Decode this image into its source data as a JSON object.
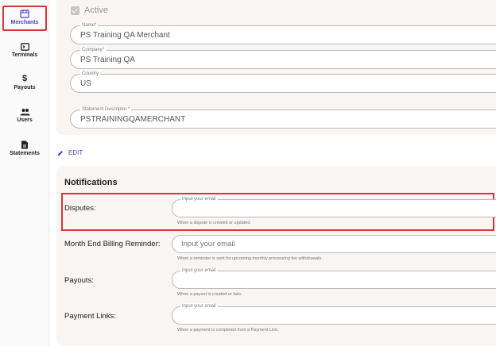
{
  "sidebar": {
    "items": [
      {
        "label": "Merchants",
        "icon": "storefront-icon",
        "active": true
      },
      {
        "label": "Terminals",
        "icon": "terminal-icon",
        "active": false
      },
      {
        "label": "Payouts",
        "icon": "dollar-icon",
        "active": false
      },
      {
        "label": "Users",
        "icon": "users-icon",
        "active": false
      },
      {
        "label": "Statements",
        "icon": "document-icon",
        "active": false
      }
    ]
  },
  "merchant": {
    "active_label": "Active",
    "fields": [
      {
        "label": "Name",
        "required": true,
        "value": "PS Training QA Merchant"
      },
      {
        "label": "Company",
        "required": true,
        "value": "PS Training QA"
      },
      {
        "label": "Country",
        "required": false,
        "value": "US"
      },
      {
        "label": "Statement Descriptor",
        "required": true,
        "value": "PSTRAININGQAMERCHANT"
      }
    ]
  },
  "edit_label": "EDIT",
  "notifications": {
    "title": "Notifications",
    "rows": [
      {
        "label": "Disputes:",
        "field_label": "Input your email",
        "placeholder": "",
        "helper": "When a dispute is created or updated."
      },
      {
        "label": "Month End Billing Reminder:",
        "field_label": "",
        "placeholder": "Input your email",
        "helper": "When a reminder is sent for upcoming monthly processing fee withdrawals."
      },
      {
        "label": "Payouts:",
        "field_label": "Input your email",
        "placeholder": "",
        "helper": "When a payout is created or fails."
      },
      {
        "label": "Payment Links:",
        "field_label": "Input your email",
        "placeholder": "",
        "helper": "When a payment is completed from a Payment Link."
      }
    ]
  },
  "colors": {
    "accent": "#5b3bc4",
    "highlight": "#d9343c",
    "panel": "#f8f5f3"
  }
}
